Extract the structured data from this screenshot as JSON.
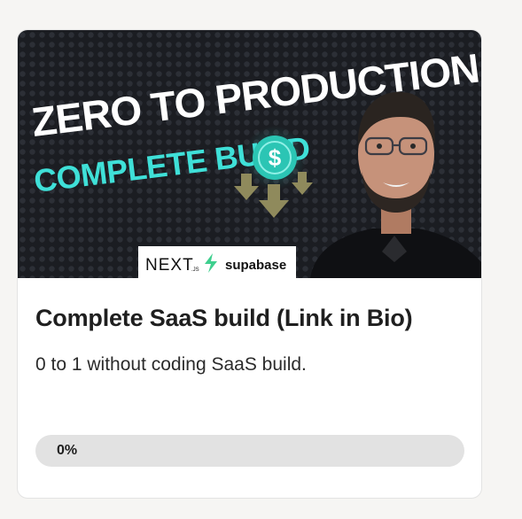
{
  "course_card": {
    "thumbnail": {
      "headline": "ZERO TO PRODUCTION",
      "subheadline": "COMPLETE BUILD",
      "coin_symbol": "$",
      "brand_next": "NEXT",
      "brand_next_suffix": ".JS",
      "brand_supabase": "supabase",
      "colors": {
        "background": "#1b1d22",
        "headline": "#ffffff",
        "subheadline": "#3fe0d8",
        "coin": "#2bc5b4",
        "supabase_bolt": "#3ecf8e"
      }
    },
    "title": "Complete SaaS build (Link in Bio)",
    "description": "0 to 1 without coding SaaS build.",
    "progress": {
      "value": 0,
      "label": "0%"
    }
  }
}
